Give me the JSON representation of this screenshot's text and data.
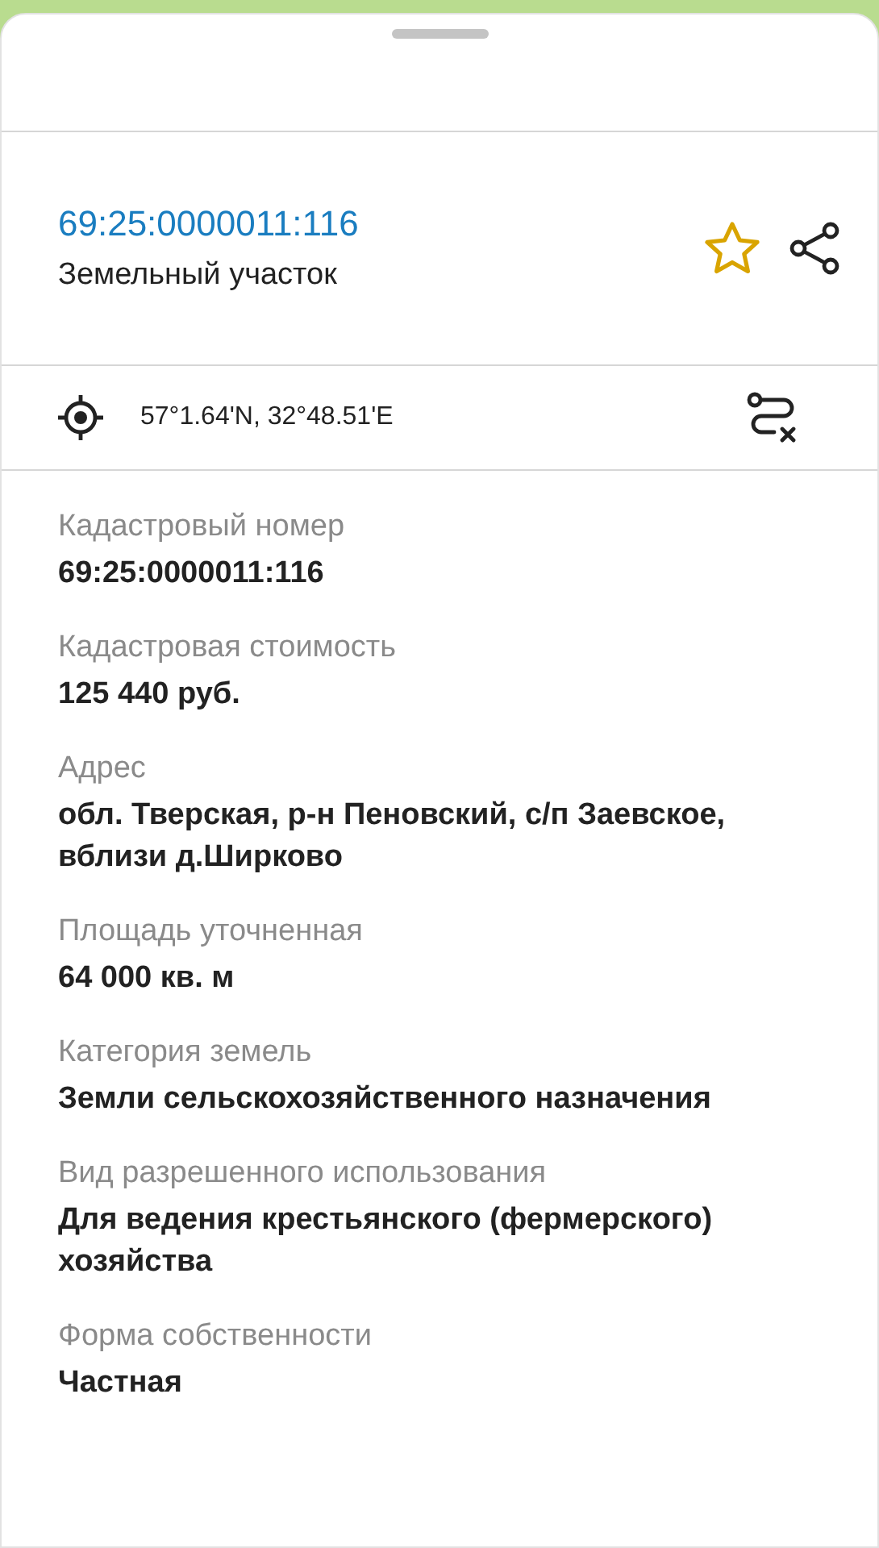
{
  "header": {
    "title": "69:25:0000011:116",
    "subtitle": "Земельный участок",
    "favorite": false
  },
  "location": {
    "coordinates": "57°1.64'N, 32°48.51'E"
  },
  "fields": [
    {
      "label": "Кадастровый номер",
      "value": "69:25:0000011:116"
    },
    {
      "label": "Кадастровая стоимость",
      "value": "125 440 руб."
    },
    {
      "label": "Адрес",
      "value": "обл. Тверская, р-н Пеновский, с/п Заевское, вблизи д.Ширково"
    },
    {
      "label": "Площадь уточненная",
      "value": "64 000 кв. м"
    },
    {
      "label": "Категория земель",
      "value": "Земли сельскохозяйственного назначения"
    },
    {
      "label": "Вид разрешенного использования",
      "value": "Для ведения крестьянского (фермерского) хозяйства"
    },
    {
      "label": "Форма собственности",
      "value": "Частная"
    }
  ]
}
